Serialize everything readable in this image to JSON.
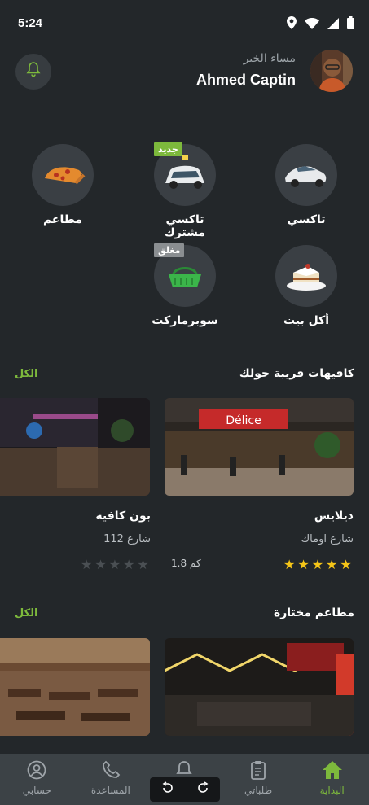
{
  "status": {
    "time": "5:24"
  },
  "header": {
    "greeting": "مساء الخير",
    "username": "Ahmed Captin"
  },
  "categories": [
    {
      "label": "تاكسي",
      "badge": ""
    },
    {
      "label": "تاكسي مشترك",
      "badge": "جديد"
    },
    {
      "label": "مطاعم",
      "badge": ""
    },
    {
      "label": "أكل بيت",
      "badge": ""
    },
    {
      "label": "سوبرماركت",
      "badge": "مغلق"
    }
  ],
  "nearby_cafes": {
    "title": "كافيهات قريبة حولك",
    "see_all": "الكل",
    "cards": [
      {
        "name": "ديلايس",
        "street": "شارع اوماك",
        "distance": "1.8 كم",
        "rating": 5,
        "sign": "Délice"
      },
      {
        "name": "بون كافيه",
        "street": "شارع 112",
        "distance": "",
        "rating": 0
      }
    ]
  },
  "chosen_restaurants": {
    "title": "مطاعم مختارة",
    "see_all": "الكل"
  },
  "nav": {
    "items": [
      {
        "label": "البداية",
        "active": true
      },
      {
        "label": "طلباتي",
        "active": false
      },
      {
        "label": "",
        "active": false
      },
      {
        "label": "المساعدة",
        "active": false
      },
      {
        "label": "حسابي",
        "active": false
      }
    ]
  },
  "colors": {
    "accent": "#7db93c",
    "background": "#23272a",
    "star": "#f5c518"
  }
}
